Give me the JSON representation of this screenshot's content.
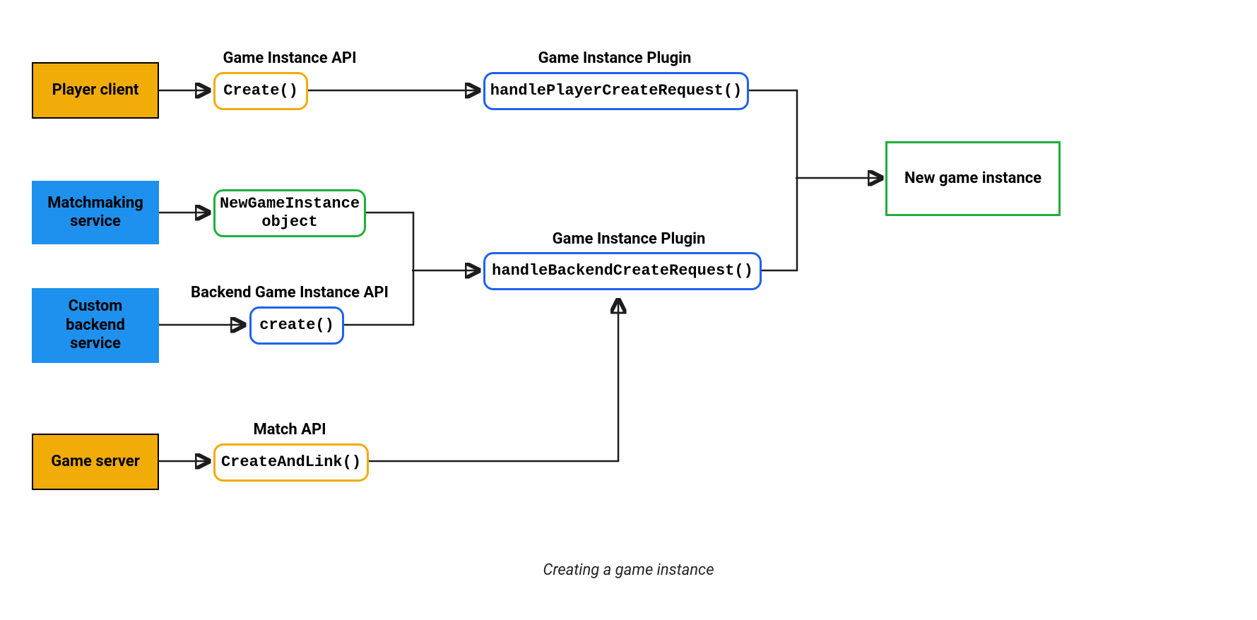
{
  "caption": "Creating a game instance",
  "sources": {
    "player_client": "Player client",
    "matchmaking_service": "Matchmaking service",
    "custom_backend_service": "Custom backend service",
    "game_server": "Game server"
  },
  "api_labels": {
    "game_instance_api": "Game Instance API",
    "backend_game_instance_api": "Backend Game Instance API",
    "match_api": "Match API"
  },
  "api_nodes": {
    "create_player": "Create()",
    "new_game_instance_object": "NewGameInstance object",
    "create_backend": "create()",
    "create_and_link": "CreateAndLink()"
  },
  "plugin_labels": {
    "player_plugin": "Game Instance Plugin",
    "backend_plugin": "Game Instance Plugin"
  },
  "plugin_nodes": {
    "handle_player_create": "handlePlayerCreateRequest()",
    "handle_backend_create": "handleBackendCreateRequest()"
  },
  "result": {
    "new_game_instance": "New game instance"
  },
  "colors": {
    "orange": "#f1ac09",
    "blue_fill": "#1e91ee",
    "blue_border": "#1e62ee",
    "green": "#1fae3d"
  }
}
